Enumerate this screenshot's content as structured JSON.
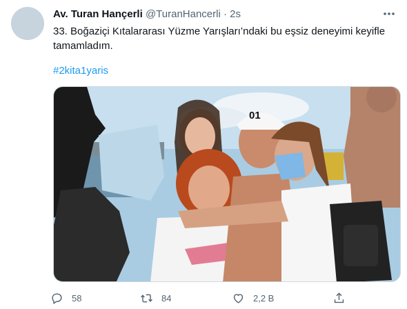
{
  "author": {
    "display_name": "Av. Turan Hançerli",
    "handle": "@TuranHancerli",
    "separator": "·",
    "time": "2s"
  },
  "tweet": {
    "text": "33. Boğaziçi Kıtalararası Yüzme Yarışları’ndaki bu eşsiz deneyimi keyifle tamamladım.",
    "hashtag": "#2kita1yaris"
  },
  "photo": {
    "cap_text": "01"
  },
  "actions": {
    "reply_count": "58",
    "retweet_count": "84",
    "like_count": "2,2 B"
  },
  "icons": {
    "more": "more-horizontal-icon",
    "reply": "reply-icon",
    "retweet": "retweet-icon",
    "like": "heart-icon",
    "share": "share-icon"
  },
  "colors": {
    "link": "#1d9bf0",
    "secondary_text": "#536471"
  }
}
